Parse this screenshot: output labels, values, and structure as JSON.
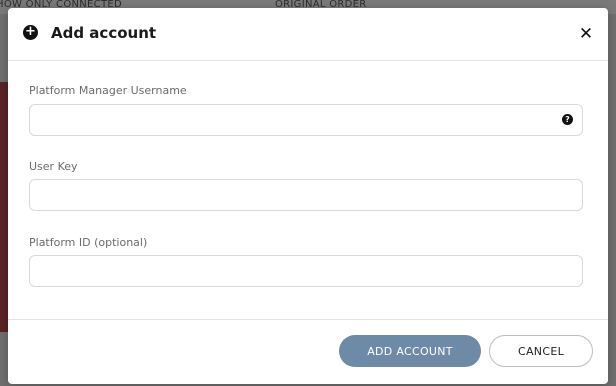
{
  "background": {
    "topbar_items": [
      "HOW ONLY CONNECTED",
      "ORIGINAL ORDER"
    ]
  },
  "dialog": {
    "title": "Add account",
    "icon": "plus-circle-icon",
    "close_icon": "close-icon",
    "fields": [
      {
        "label": "Platform Manager Username",
        "value": "",
        "placeholder": "",
        "help_icon": "question-circle-icon"
      },
      {
        "label": "User Key",
        "value": "",
        "placeholder": ""
      },
      {
        "label": "Platform ID (optional)",
        "value": "",
        "placeholder": ""
      }
    ],
    "buttons": {
      "primary": "ADD ACCOUNT",
      "secondary": "CANCEL"
    }
  },
  "colors": {
    "primary_button": "#6d8aa6",
    "overlay": "#6f6f6f",
    "accent_strip": "#5a2326"
  }
}
